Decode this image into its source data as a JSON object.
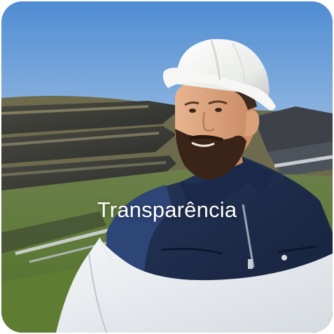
{
  "card": {
    "title": "Transparência"
  },
  "image": {
    "subject": "engineer-in-white-hard-hat-at-solar-farm"
  },
  "colors": {
    "sky_top": "#5d95d6",
    "helmet": "#f2f3f1",
    "vest": "#1d2e4f",
    "beard": "#3a2418",
    "caption": "#ffffff"
  }
}
